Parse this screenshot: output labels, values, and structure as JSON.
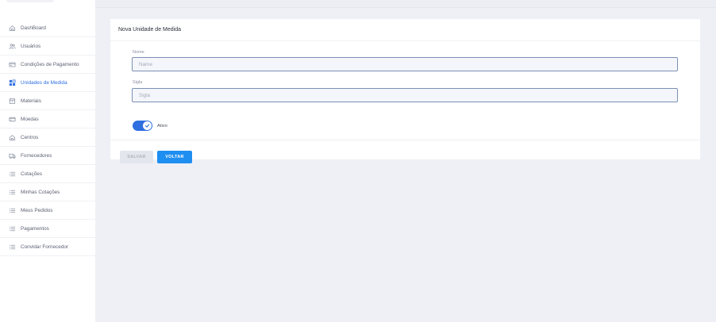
{
  "sidebar": {
    "items": [
      {
        "label": "DashBoard",
        "icon": "home-icon",
        "active": false
      },
      {
        "label": "Usuários",
        "icon": "users-icon",
        "active": false
      },
      {
        "label": "Condições de Pagamento",
        "icon": "card-icon",
        "active": false
      },
      {
        "label": "Unidades de Medida",
        "icon": "ruler-icon",
        "active": true
      },
      {
        "label": "Materiais",
        "icon": "box-icon",
        "active": false
      },
      {
        "label": "Moedas",
        "icon": "money-icon",
        "active": false
      },
      {
        "label": "Centros",
        "icon": "home-icon",
        "active": false
      },
      {
        "label": "Fornecedores",
        "icon": "truck-icon",
        "active": false
      },
      {
        "label": "Cotações",
        "icon": "list-icon",
        "active": false
      },
      {
        "label": "Minhas Cotações",
        "icon": "list-icon",
        "active": false
      },
      {
        "label": "Meus Pedidos",
        "icon": "list-icon",
        "active": false
      },
      {
        "label": "Pagamentos",
        "icon": "list-icon",
        "active": false
      },
      {
        "label": "Convidar Fornecedor",
        "icon": "list-icon",
        "active": false
      }
    ]
  },
  "form": {
    "title": "Nova Unidade de Medida",
    "nome": {
      "label": "Nome",
      "placeholder": "Name",
      "value": ""
    },
    "sigla": {
      "label": "Sigla",
      "placeholder": "Sigla",
      "value": ""
    },
    "ativo": {
      "label": "Ativo",
      "checked": true
    },
    "save_label": "SALVAR",
    "back_label": "VOLTAR"
  },
  "colors": {
    "accent": "#2f6fe0",
    "primary_button": "#1f8ef1",
    "disabled_button": "#e3e6ed",
    "background": "#eef0f6"
  }
}
